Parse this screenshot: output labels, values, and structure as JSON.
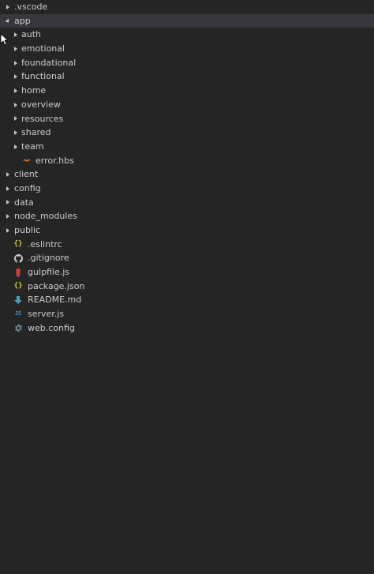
{
  "explorer": {
    "items": [
      {
        "label": ".vscode",
        "type": "folder",
        "state": "collapsed",
        "depth": 0
      },
      {
        "label": "app",
        "type": "folder",
        "state": "expanded",
        "depth": 0,
        "selected": true
      },
      {
        "label": "auth",
        "type": "folder",
        "state": "collapsed",
        "depth": 1
      },
      {
        "label": "emotional",
        "type": "folder",
        "state": "collapsed",
        "depth": 1
      },
      {
        "label": "foundational",
        "type": "folder",
        "state": "collapsed",
        "depth": 1
      },
      {
        "label": "functional",
        "type": "folder",
        "state": "collapsed",
        "depth": 1
      },
      {
        "label": "home",
        "type": "folder",
        "state": "collapsed",
        "depth": 1
      },
      {
        "label": "overview",
        "type": "folder",
        "state": "collapsed",
        "depth": 1
      },
      {
        "label": "resources",
        "type": "folder",
        "state": "collapsed",
        "depth": 1
      },
      {
        "label": "shared",
        "type": "folder",
        "state": "collapsed",
        "depth": 1
      },
      {
        "label": "team",
        "type": "folder",
        "state": "collapsed",
        "depth": 1
      },
      {
        "label": "error.hbs",
        "type": "file",
        "icon": "handlebars-icon",
        "depth": 2
      },
      {
        "label": "client",
        "type": "folder",
        "state": "collapsed",
        "depth": 0
      },
      {
        "label": "config",
        "type": "folder",
        "state": "collapsed",
        "depth": 0
      },
      {
        "label": "data",
        "type": "folder",
        "state": "collapsed",
        "depth": 0
      },
      {
        "label": "node_modules",
        "type": "folder",
        "state": "collapsed",
        "depth": 0
      },
      {
        "label": "public",
        "type": "folder",
        "state": "collapsed",
        "depth": 0
      },
      {
        "label": ".eslintrc",
        "type": "file",
        "icon": "json-braces-icon",
        "depth": 1
      },
      {
        "label": ".gitignore",
        "type": "file",
        "icon": "github-icon",
        "depth": 1
      },
      {
        "label": "gulpfile.js",
        "type": "file",
        "icon": "gulp-icon",
        "depth": 1
      },
      {
        "label": "package.json",
        "type": "file",
        "icon": "json-braces-icon",
        "depth": 1
      },
      {
        "label": "README.md",
        "type": "file",
        "icon": "markdown-download-icon",
        "depth": 1
      },
      {
        "label": "server.js",
        "type": "file",
        "icon": "javascript-icon",
        "depth": 1
      },
      {
        "label": "web.config",
        "type": "file",
        "icon": "gear-icon",
        "depth": 1
      }
    ]
  },
  "colors": {
    "background": "#252526",
    "selected_row": "#37373d",
    "text": "#cccccc",
    "json_icon": "#cbcb41",
    "handlebars_icon": "#e37933",
    "gulp_icon": "#cc3e44",
    "markdown_icon": "#519aba",
    "js_icon": "#519aba",
    "gear_icon": "#6d8086",
    "github_icon": "#cccccc"
  }
}
